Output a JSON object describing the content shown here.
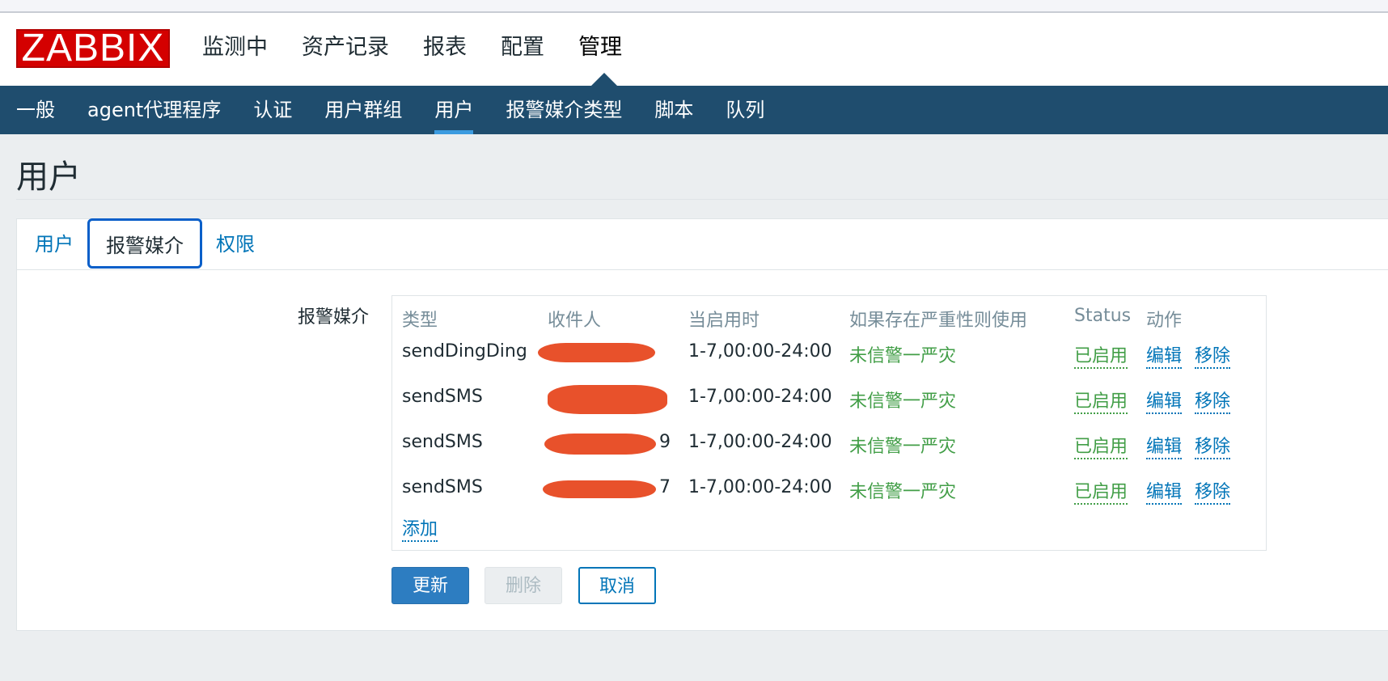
{
  "logo": "ZABBIX",
  "main_menu": [
    "监测中",
    "资产记录",
    "报表",
    "配置",
    "管理"
  ],
  "main_menu_active": "管理",
  "sub_menu": [
    "一般",
    "agent代理程序",
    "认证",
    "用户群组",
    "用户",
    "报警媒介类型",
    "脚本",
    "队列"
  ],
  "sub_menu_active": "用户",
  "page_title": "用户",
  "tabs": [
    "用户",
    "报警媒介",
    "权限"
  ],
  "active_tab": "报警媒介",
  "form_label": "报警媒介",
  "table": {
    "headers": [
      "类型",
      "收件人",
      "当启用时",
      "如果存在严重性则使用",
      "Status",
      "动作"
    ],
    "rows": [
      {
        "type": "sendDingDing",
        "recipient_visible": "",
        "when_active": "1-7,00:00-24:00",
        "severity": "未信警一严灾",
        "status": "已启用",
        "edit": "编辑",
        "remove": "移除"
      },
      {
        "type": "sendSMS",
        "recipient_visible": "",
        "when_active": "1-7,00:00-24:00",
        "severity": "未信警一严灾",
        "status": "已启用",
        "edit": "编辑",
        "remove": "移除"
      },
      {
        "type": "sendSMS",
        "recipient_visible": "9",
        "when_active": "1-7,00:00-24:00",
        "severity": "未信警一严灾",
        "status": "已启用",
        "edit": "编辑",
        "remove": "移除"
      },
      {
        "type": "sendSMS",
        "recipient_visible": "7",
        "when_active": "1-7,00:00-24:00",
        "severity": "未信警一严灾",
        "status": "已启用",
        "edit": "编辑",
        "remove": "移除"
      }
    ],
    "add_link": "添加"
  },
  "buttons": {
    "update": "更新",
    "delete": "删除",
    "cancel": "取消"
  },
  "colors": {
    "brand": "#d40000",
    "subbar": "#1f4d6e",
    "link": "#0275b8",
    "enabled": "#429e47",
    "primary": "#2d7dc1",
    "redaction": "#e8512b"
  }
}
